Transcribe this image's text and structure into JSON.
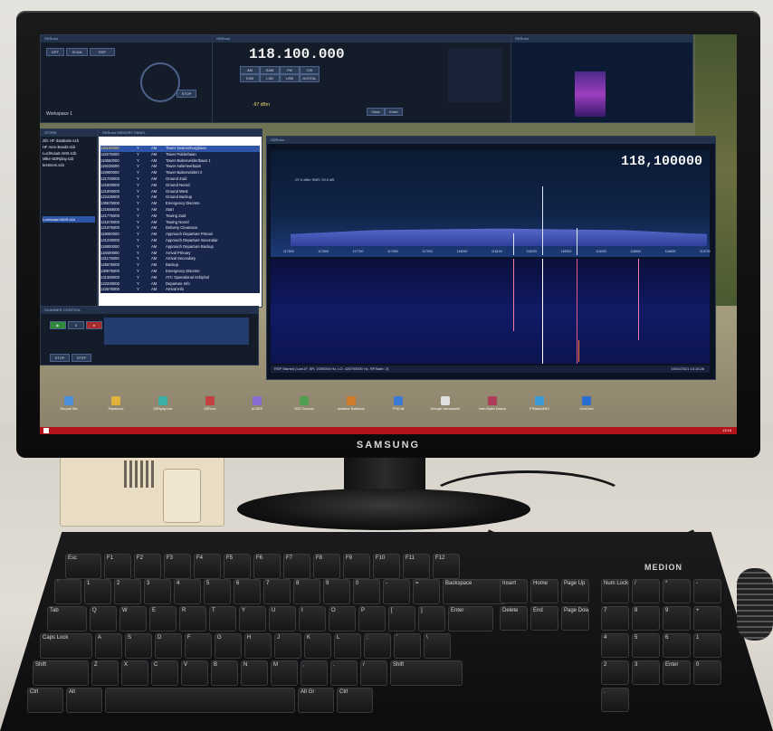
{
  "monitor": {
    "brand": "SAMSUNG"
  },
  "keyboard": {
    "brand": "MEDION",
    "row_fn": [
      "Esc",
      "F1",
      "F2",
      "F3",
      "F4",
      "F5",
      "F6",
      "F7",
      "F8",
      "F9",
      "F10",
      "F11",
      "F12"
    ],
    "row_num": [
      "`",
      "1",
      "2",
      "3",
      "4",
      "5",
      "6",
      "7",
      "8",
      "9",
      "0",
      "-",
      "=",
      "Backspace"
    ],
    "row_q": [
      "Tab",
      "Q",
      "W",
      "E",
      "R",
      "T",
      "Y",
      "U",
      "I",
      "O",
      "P",
      "[",
      "]",
      "Enter"
    ],
    "row_a": [
      "Caps Lock",
      "A",
      "S",
      "D",
      "F",
      "G",
      "H",
      "J",
      "K",
      "L",
      ";",
      "'",
      "\\"
    ],
    "row_z": [
      "Shift",
      "Z",
      "X",
      "C",
      "V",
      "B",
      "N",
      "M",
      ",",
      ".",
      "/",
      "Shift"
    ],
    "row_space": [
      "Ctrl",
      "Alt",
      "",
      "Alt Gr",
      "Ctrl"
    ],
    "nav": [
      "Insert",
      "Home",
      "Page Up",
      "Delete",
      "End",
      "Page Down"
    ],
    "numpad": [
      "Num Lock",
      "/",
      "*",
      "-",
      "7",
      "8",
      "9",
      "+",
      "4",
      "5",
      "6",
      "1",
      "2",
      "3",
      "Enter",
      "0",
      "."
    ]
  },
  "sdr": {
    "app_name": "SDRuno",
    "frequency": "118.100.000",
    "spectrum_frequency": "118,100000",
    "workspace": "Workspace 1",
    "status_bar": "RSP Started (Low-IF, SR: 2000000 Hz, LO: 426793000 Hz, RFState: 2)",
    "clock": "19/02/2021 13:16:26",
    "zoom": "ZOOM",
    "step_lock": "STEP LOCK",
    "signal_level": "-97 dBm",
    "snr": "-97.0 dBm  SNR: 29.0 dB",
    "memory_panel_title": "SDRuno MEMORY PANEL",
    "scanner_title": "SCANNER CONTROL",
    "scan_buttons": [
      "STOP",
      "STEP"
    ],
    "right_buttons": [
      "Clear",
      "Enter"
    ],
    "mode_buttons": [
      "AM",
      "SAM",
      "FM",
      "CW",
      "DSB",
      "LSB",
      "USB",
      "DIGITAL"
    ],
    "spectrum_axis": [
      "117500",
      "117600",
      "117700",
      "117800",
      "117900",
      "118000",
      "118100",
      "118200",
      "118300",
      "118400",
      "118500",
      "118600",
      "118700"
    ],
    "files": [
      "Zib: HF database.s1b",
      "HF Aero Bands.s1b",
      "Luchtvaart AMS.s1b",
      "Mike-SDRplay.s1b",
      "testmem.s1b"
    ],
    "selected_file": "Luchtvaart AMS.s1b",
    "memory_rows": [
      [
        "118100000",
        "Y",
        "AM",
        "Tower Zwanenburgbaan"
      ],
      [
        "118275000",
        "Y",
        "AM",
        "Tower Polderbaan"
      ],
      [
        "118550000",
        "Y",
        "AM",
        "Tower Buitenveldertbaan 1"
      ],
      [
        "119225000",
        "Y",
        "AM",
        "Tower Aalsmeerbaan"
      ],
      [
        "119900000",
        "Y",
        "AM",
        "Tower Buitenveldert 2"
      ],
      [
        "121700000",
        "Y",
        "AM",
        "Ground Zuid"
      ],
      [
        "121800000",
        "Y",
        "AM",
        "Ground Noord"
      ],
      [
        "121900000",
        "Y",
        "AM",
        "Ground West"
      ],
      [
        "122425000",
        "Y",
        "AM",
        "Ground Backup"
      ],
      [
        "130675000",
        "Y",
        "AM",
        "Emergency Discrete"
      ],
      [
        "121650000",
        "Y",
        "AM",
        "Start"
      ],
      [
        "121775000",
        "Y",
        "AM",
        "Towing Zuid"
      ],
      [
        "121675000",
        "Y",
        "AM",
        "Towing Noord"
      ],
      [
        "121975000",
        "Y",
        "AM",
        "Delivery Clearance"
      ],
      [
        "119050000",
        "Y",
        "AM",
        "Approach Departure Primair"
      ],
      [
        "131200000",
        "Y",
        "AM",
        "Approach Departure Secondair"
      ],
      [
        "118800000",
        "Y",
        "AM",
        "Approach Departure Backup"
      ],
      [
        "118400000",
        "Y",
        "AM",
        "Arrival Primary"
      ],
      [
        "131175000",
        "Y",
        "AM",
        "Arrival Secondary"
      ],
      [
        "126675000",
        "Y",
        "AM",
        "Backup"
      ],
      [
        "130675000",
        "Y",
        "AM",
        "Emergency Discrete"
      ],
      [
        "131350000",
        "Y",
        "AM",
        "ATC Operational Schiphol"
      ],
      [
        "122200000",
        "Y",
        "AM",
        "Departure Info"
      ],
      [
        "122575000",
        "Y",
        "AM",
        "Arrival Info"
      ]
    ]
  },
  "desktop_icons": [
    "Recycle Bin",
    "Panasonic",
    "SDRplay Adv",
    "SDRuno",
    "ACARS",
    "SDR Console",
    "Amateur Notebook",
    "FT8Call",
    "Energie Nieuwsbrief",
    "Ham Radio Deluxe",
    "FTBasicMMO",
    "OneDrive"
  ],
  "taskbar": {
    "time": "13:16"
  }
}
